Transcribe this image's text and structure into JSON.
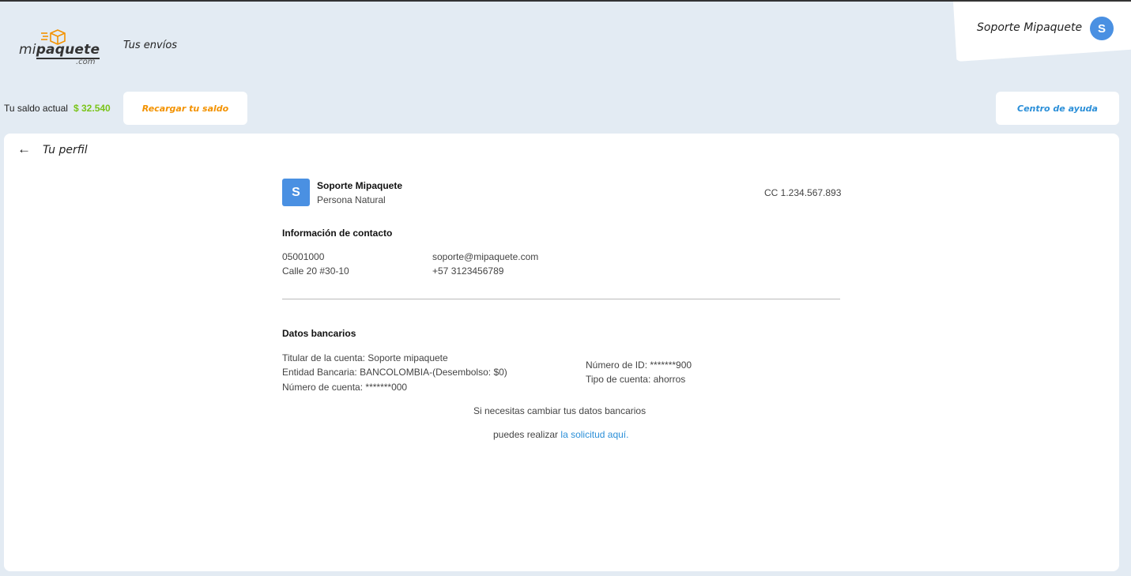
{
  "header": {
    "logo_text_prefix": "mi",
    "logo_text_bold": "paquete",
    "logo_suffix": ".com",
    "nav_link": "Tus envíos",
    "user_name": "Soporte Mipaquete",
    "user_initial": "S"
  },
  "toolbar": {
    "balance_label": "Tu saldo actual",
    "balance_amount": "$ 32.540",
    "recharge_label": "Recargar tu saldo",
    "help_label": "Centro de ayuda"
  },
  "profile": {
    "back_icon": "arrow-left-icon",
    "title": "Tu perfil",
    "initial": "S",
    "name": "Soporte Mipaquete",
    "person_type": "Persona Natural",
    "id_document": "CC 1.234.567.893",
    "contact_title": "Información de contacto",
    "postal_code": "05001000",
    "address": "Calle 20 #30-10",
    "email": "soporte@mipaquete.com",
    "phone": "+57 3123456789",
    "bank_title": "Datos bancarios",
    "account_holder": "Titular de la cuenta: Soporte mipaquete",
    "bank_entity": "Entidad Bancaria: BANCOLOMBIA-(Desembolso: $0)",
    "account_number": "Número de cuenta: *******000",
    "id_number": "Número de ID: *******900",
    "account_type": "Tipo de cuenta: ahorros",
    "change_note": "Si necesitas cambiar tus datos bancarios",
    "request_prefix": "puedes realizar",
    "request_link": "la solicitud aquí."
  },
  "colors": {
    "accent_blue": "#4a90e2",
    "balance_green": "#7ac41a",
    "recharge_orange": "#f39200",
    "link_blue": "#2b8fd8"
  }
}
